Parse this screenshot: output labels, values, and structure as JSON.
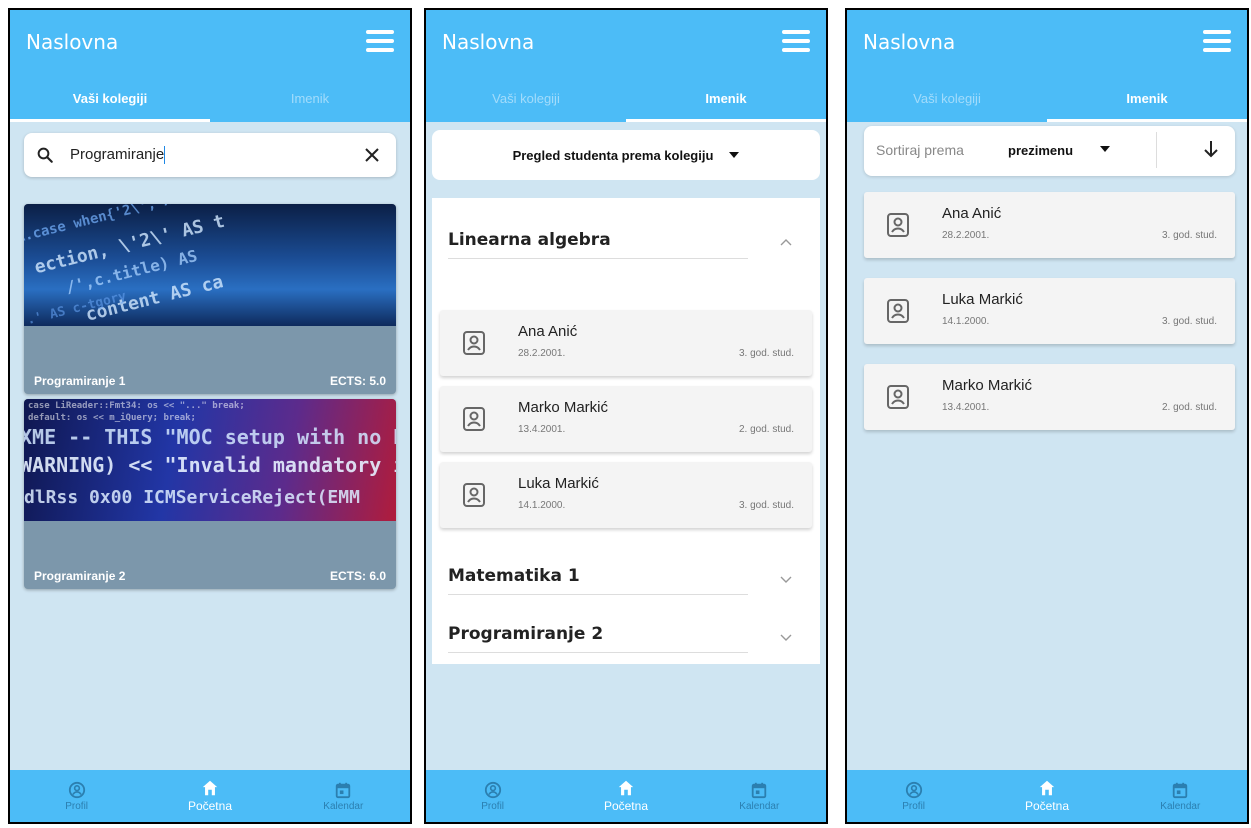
{
  "app": {
    "title": "Naslovna",
    "tabs": [
      "Vaši kolegiji",
      "Imenik"
    ],
    "nav": [
      {
        "label": "Profil",
        "icon": "account-circle-icon"
      },
      {
        "label": "Početna",
        "icon": "home-icon"
      },
      {
        "label": "Kalendar",
        "icon": "calendar-icon"
      }
    ],
    "colors": {
      "primary": "#4cbcf7",
      "background": "#cfe5f2",
      "card": "#7c97ab"
    }
  },
  "screen1": {
    "search": {
      "value": "Programiranje",
      "icon": "search-icon",
      "clear_icon": "close-icon"
    },
    "courses": [
      {
        "name": "Programiranje 1",
        "ects": "ECTS: 5.0"
      },
      {
        "name": "Programiranje 2",
        "ects": "ECTS: 6.0"
      }
    ]
  },
  "screen2": {
    "dropdown_label": "Pregled studenta prema kolegiju",
    "sections": [
      {
        "title": "Linearna algebra",
        "expanded": true,
        "students": [
          {
            "name": "Ana Anić",
            "date": "28.2.2001.",
            "year": "3. god. stud."
          },
          {
            "name": "Marko Markić",
            "date": "13.4.2001.",
            "year": "2. god. stud."
          },
          {
            "name": "Luka Markić",
            "date": "14.1.2000.",
            "year": "3. god. stud."
          }
        ]
      },
      {
        "title": "Matematika 1",
        "expanded": false
      },
      {
        "title": "Programiranje 2",
        "expanded": false
      }
    ]
  },
  "screen3": {
    "sort_label": "Sortiraj prema",
    "sort_value": "prezimenu",
    "students": [
      {
        "name": "Ana Anić",
        "date": "28.2.2001.",
        "year": "3. god. stud."
      },
      {
        "name": "Luka Markić",
        "date": "14.1.2000.",
        "year": "3. god. stud."
      },
      {
        "name": "Marko Markić",
        "date": "13.4.2001.",
        "year": "2. god. stud."
      }
    ]
  }
}
